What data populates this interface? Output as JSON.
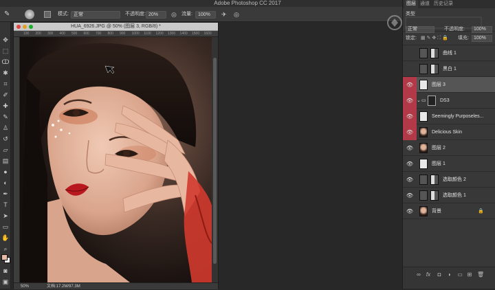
{
  "app": {
    "title": "Adobe Photoshop CC 2017"
  },
  "options_bar": {
    "mode_label": "模式:",
    "mode_value": "正常",
    "opacity_label": "不透明度:",
    "opacity_value": "20%",
    "flow_label": "流量:",
    "flow_value": "100%"
  },
  "document": {
    "title": "HUA_6926.JPG @ 50% (图层 3, RGB/8) *",
    "ruler_labels": [
      "100",
      "200",
      "300",
      "400",
      "500",
      "600",
      "700",
      "800",
      "900",
      "1000",
      "1100",
      "1200",
      "1300",
      "1400",
      "1500",
      "1600"
    ],
    "zoom": "50%",
    "doc_size": "文档:17.2M/97.3M"
  },
  "panel": {
    "tabs": [
      "图层",
      "通道",
      "历史记录"
    ],
    "blend_mode": "正常",
    "opacity_label": "不透明度:",
    "opacity_value": "100%",
    "lock_label": "锁定:",
    "fill_label": "填充:",
    "fill_value": "100%",
    "kind_label": "类型"
  },
  "layers": [
    {
      "name": "曲线 1",
      "visible": false,
      "selected": false,
      "red": false,
      "thumb": "adjust"
    },
    {
      "name": "黑白 1",
      "visible": false,
      "selected": false,
      "red": false,
      "thumb": "adjust"
    },
    {
      "name": "图层 3",
      "visible": true,
      "selected": true,
      "red": true,
      "thumb": "blank"
    },
    {
      "name": "DS3",
      "visible": true,
      "selected": false,
      "red": true,
      "thumb": "group"
    },
    {
      "name": "Seemingly Purposeles...",
      "visible": true,
      "selected": false,
      "red": true,
      "thumb": "blank"
    },
    {
      "name": "Delicious Skin",
      "visible": true,
      "selected": false,
      "red": true,
      "thumb": "photo"
    },
    {
      "name": "图层 2",
      "visible": true,
      "selected": false,
      "red": false,
      "thumb": "photo"
    },
    {
      "name": "图层 1",
      "visible": true,
      "selected": false,
      "red": false,
      "thumb": "blank"
    },
    {
      "name": "选取颜色 2",
      "visible": true,
      "selected": false,
      "red": false,
      "thumb": "adjust"
    },
    {
      "name": "选取颜色 1",
      "visible": true,
      "selected": false,
      "red": false,
      "thumb": "adjust"
    },
    {
      "name": "背景",
      "visible": true,
      "selected": false,
      "red": false,
      "thumb": "photo",
      "locked": true
    }
  ],
  "colors": {
    "selected_row": "#555555",
    "visibility_red": "#b23a48",
    "foreground": "#e7bba5",
    "background": "#ffffff"
  }
}
